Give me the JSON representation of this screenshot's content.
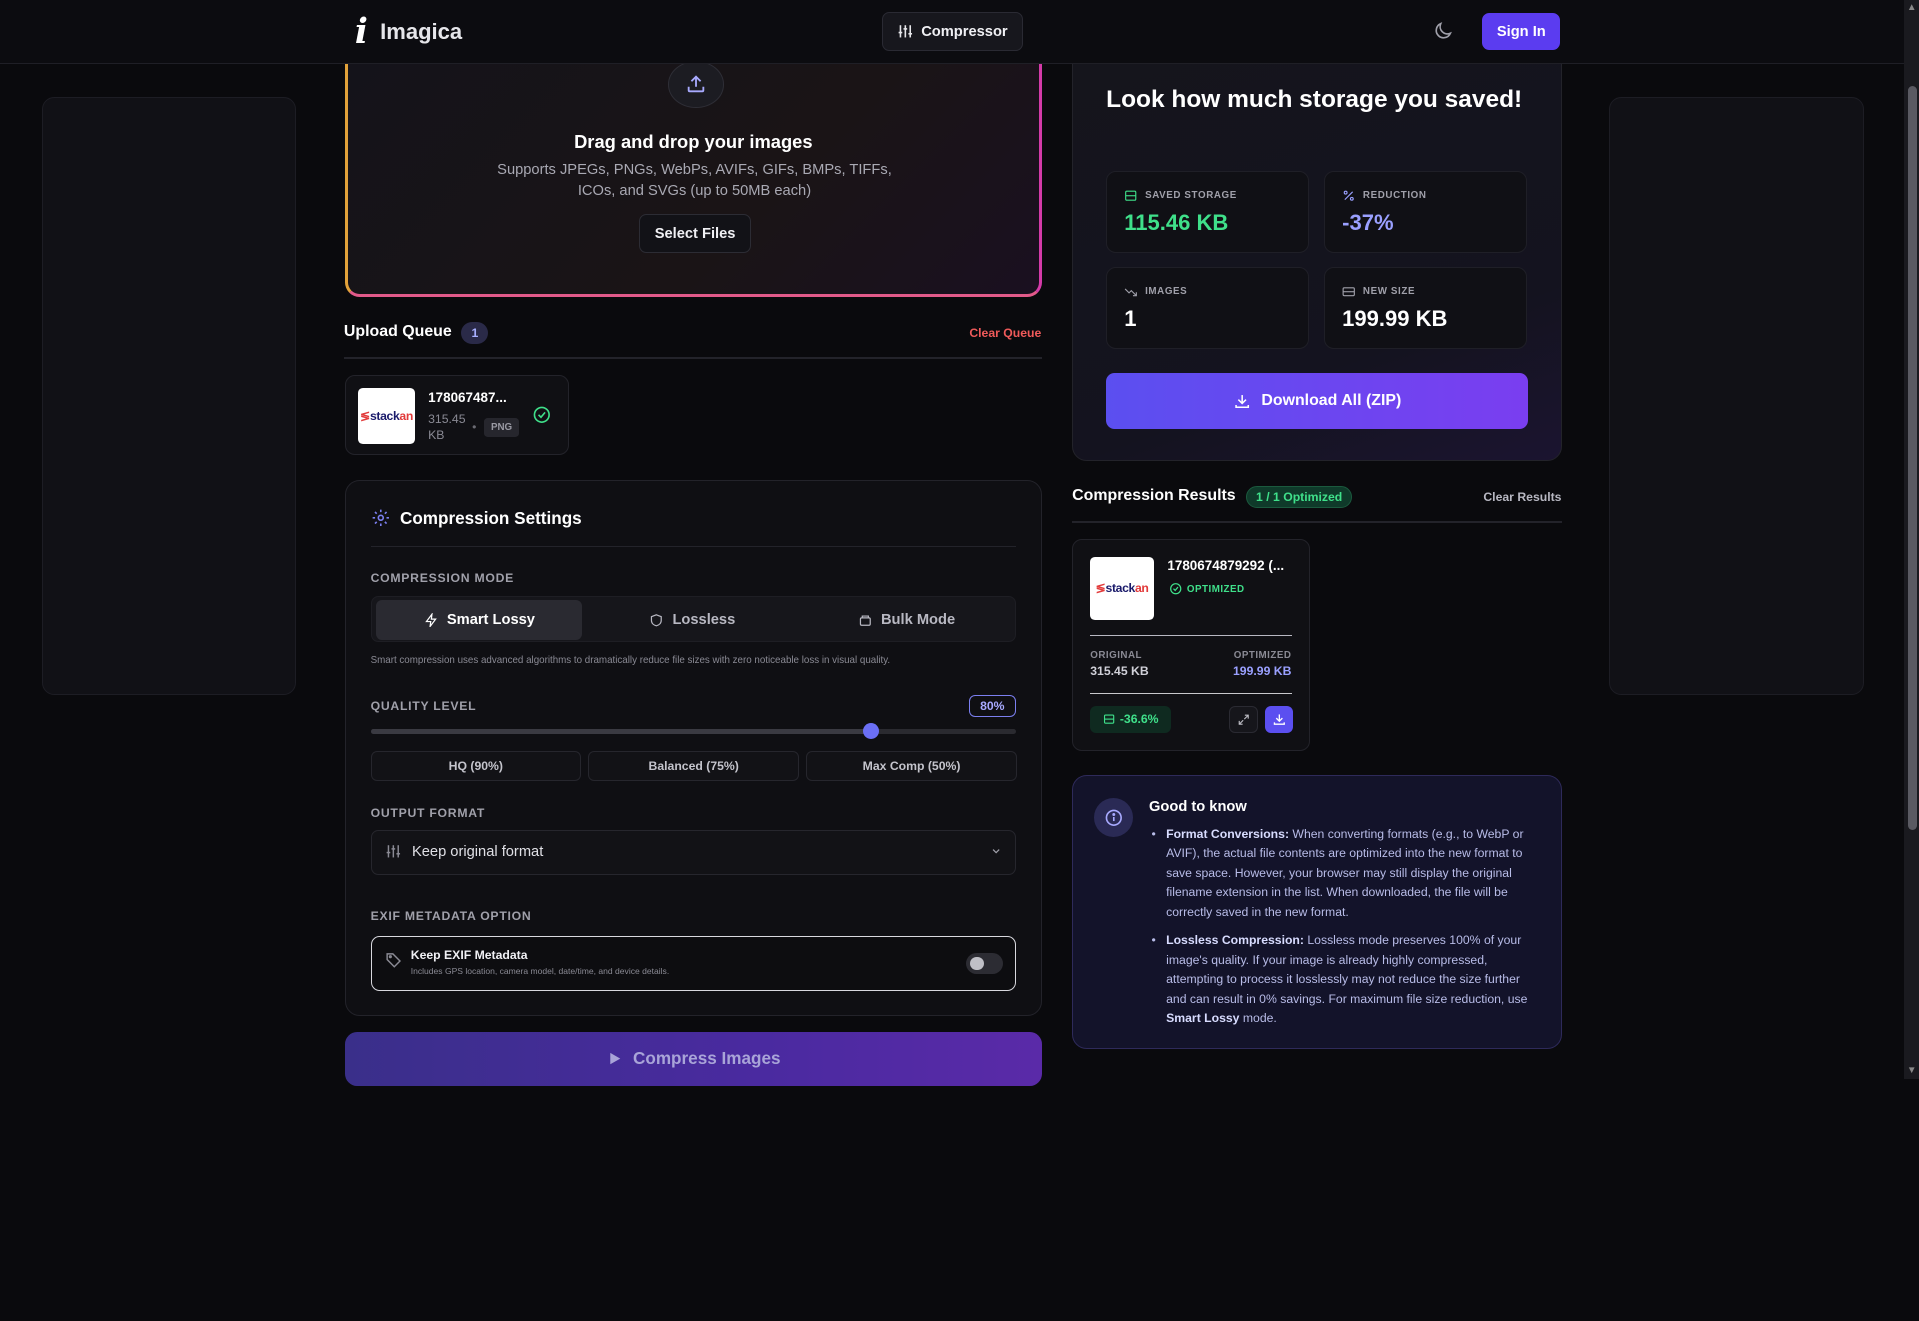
{
  "nav": {
    "logo_mark": "i",
    "logo_text": "Imagica",
    "compressor_label": "Compressor",
    "signin_label": "Sign In"
  },
  "dropzone": {
    "title": "Drag and drop your images",
    "subtitle": "Supports JPEGs, PNGs, WebPs, AVIFs, GIFs, BMPs, TIFFs, ICOs, and SVGs (up to 50MB each)",
    "button_label": "Select Files"
  },
  "queue": {
    "title": "Upload Queue",
    "count": "1",
    "clear_label": "Clear Queue",
    "items": [
      {
        "name": "178067487...",
        "size": "315.45 KB",
        "format": "PNG",
        "thumb_text_a": "stack",
        "thumb_text_b": "an"
      }
    ]
  },
  "settings": {
    "title": "Compression Settings",
    "mode_label": "COMPRESSION MODE",
    "modes": [
      {
        "label": "Smart Lossy",
        "active": true
      },
      {
        "label": "Lossless",
        "active": false
      },
      {
        "label": "Bulk Mode",
        "active": false
      }
    ],
    "mode_description": "Smart compression uses advanced algorithms to dramatically reduce file sizes with zero noticeable loss in visual quality.",
    "quality_label": "QUALITY LEVEL",
    "quality_value_text": "80%",
    "quality_fraction": 0.775,
    "presets": [
      "HQ (90%)",
      "Balanced (75%)",
      "Max Comp (50%)"
    ],
    "output_label": "OUTPUT FORMAT",
    "output_value": "Keep original format",
    "exif_label": "EXIF METADATA OPTION",
    "exif_title": "Keep EXIF Metadata",
    "exif_sub": "Includes GPS location, camera model, date/time, and device details.",
    "exif_enabled": false
  },
  "compress_button": "Compress Images",
  "saved": {
    "title": "Look how much storage you saved!",
    "stats": [
      {
        "label": "SAVED STORAGE",
        "value": "115.46 KB",
        "color": "#3fe08a",
        "icon": "storage-icon"
      },
      {
        "label": "REDUCTION",
        "value": "-37%",
        "color": "#9aa0ff",
        "icon": "percent-icon"
      },
      {
        "label": "IMAGES",
        "value": "1",
        "color": "#ffffff",
        "icon": "trend-down-icon"
      },
      {
        "label": "NEW SIZE",
        "value": "199.99 KB",
        "color": "#ffffff",
        "icon": "drive-icon"
      }
    ],
    "download_label": "Download All (ZIP)"
  },
  "results": {
    "title": "Compression Results",
    "badge": "1 / 1 Optimized",
    "clear_label": "Clear Results",
    "items": [
      {
        "name": "1780674879292 (...",
        "status": "OPTIMIZED",
        "original_label": "ORIGINAL",
        "original_value": "315.45 KB",
        "optimized_label": "OPTIMIZED",
        "optimized_value": "199.99 KB",
        "percent": "-36.6%"
      }
    ]
  },
  "info": {
    "title": "Good to know",
    "items": [
      {
        "heading": "Format Conversions:",
        "text": " When converting formats (e.g., to WebP or AVIF), the actual file contents are optimized into the new format to save space. However, your browser may still display the original filename extension in the list. When downloaded, the file will be correctly saved in the new format."
      },
      {
        "heading": "Lossless Compression:",
        "text": " Lossless mode preserves 100% of your image's quality. If your image is already highly compressed, attempting to process it losslessly may not reduce the size further and can result in 0% savings. For maximum file size reduction, use ",
        "bold_tail": "Smart Lossy",
        "tail": " mode."
      }
    ]
  }
}
